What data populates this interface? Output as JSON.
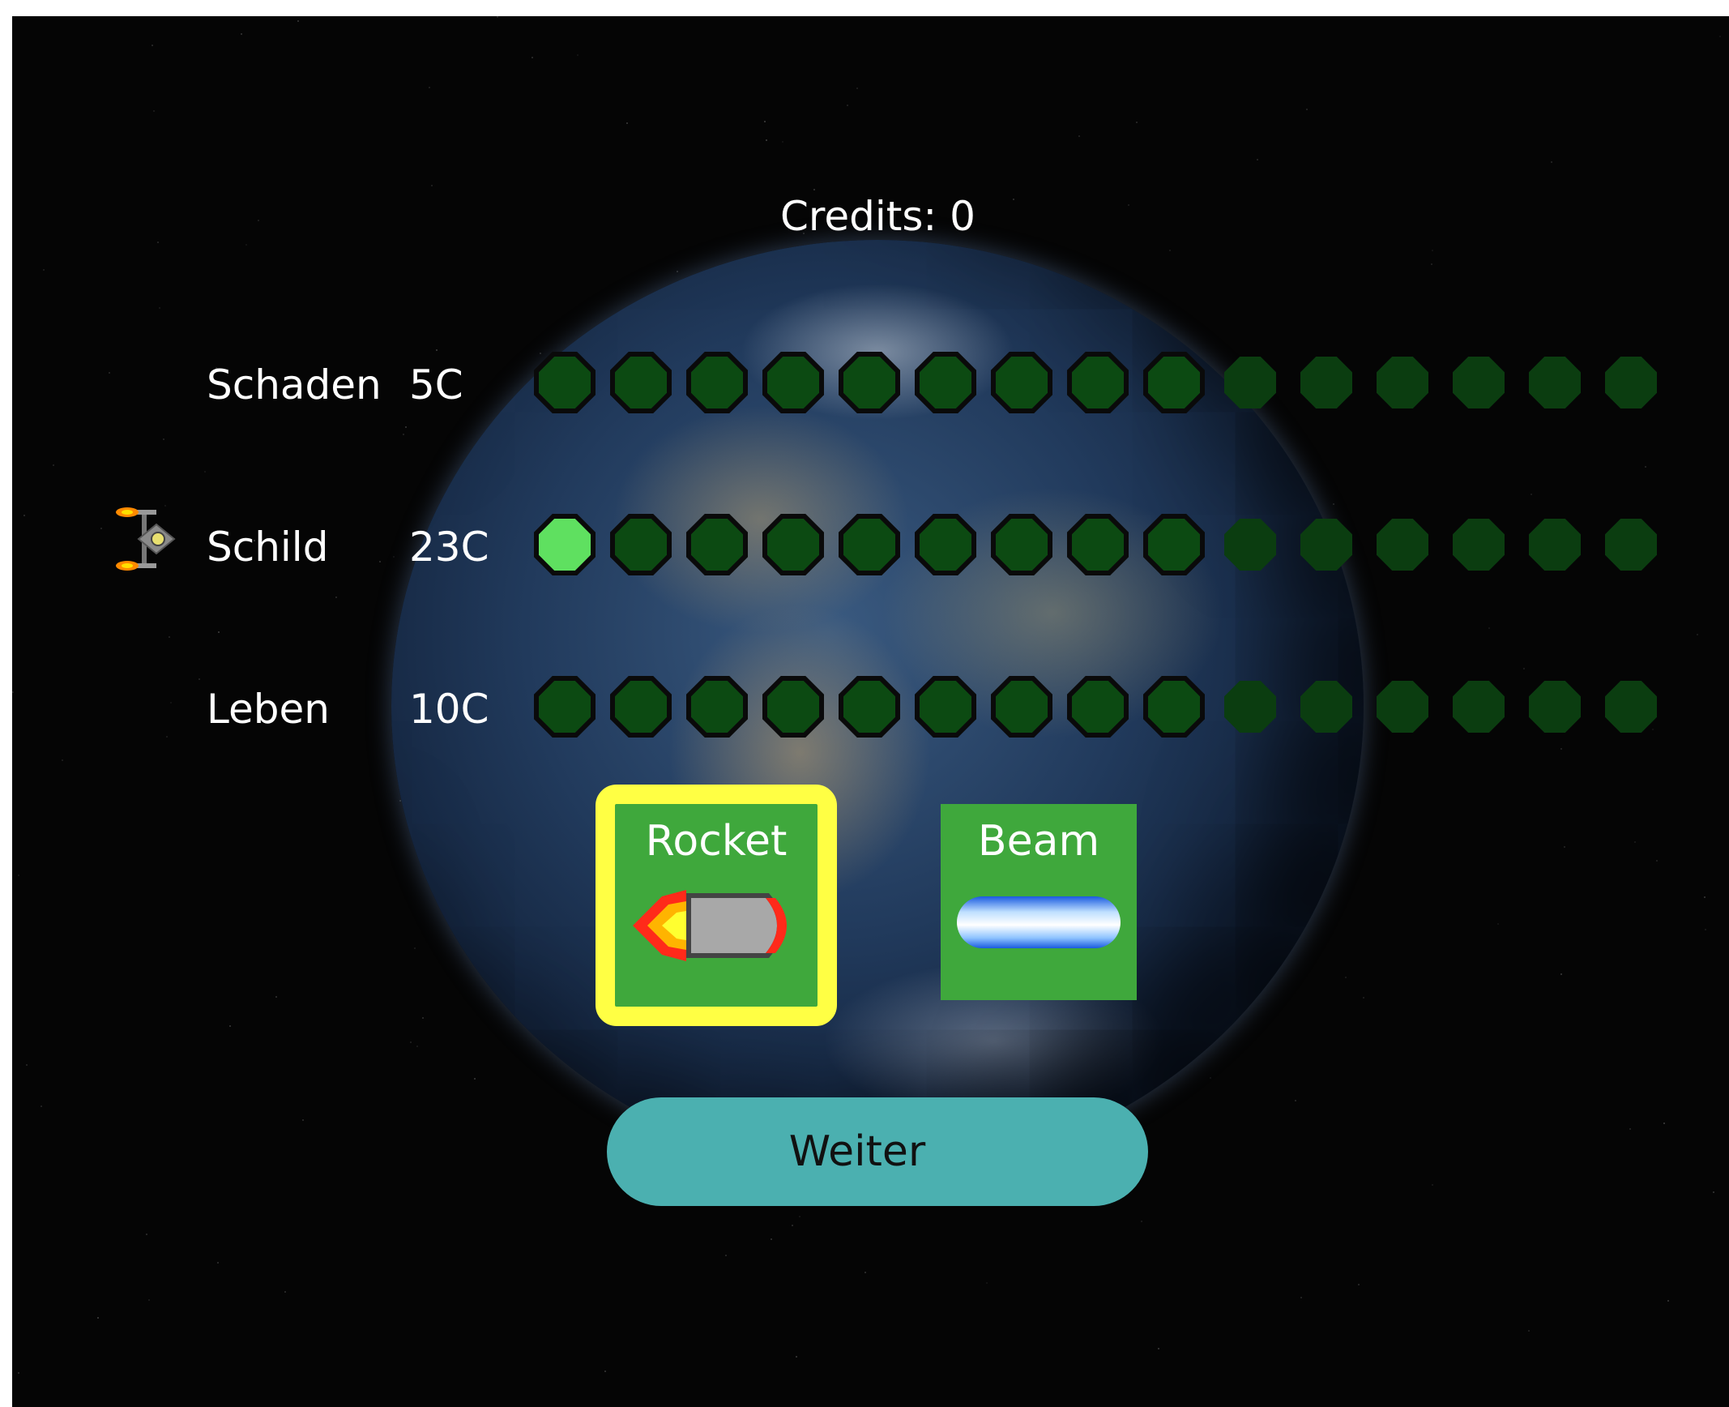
{
  "credits_text": "Credits: 0",
  "upgrades": [
    {
      "label": "Schaden",
      "cost": "5C",
      "levels_total": 15,
      "levels_filled": 0
    },
    {
      "label": "Schild",
      "cost": "23C",
      "levels_total": 15,
      "levels_filled": 1
    },
    {
      "label": "Leben",
      "cost": "10C",
      "levels_total": 15,
      "levels_filled": 0
    }
  ],
  "selected_upgrade_icon": "spaceship-icon",
  "weapons": [
    {
      "label": "Rocket",
      "icon": "rocket-icon",
      "selected": true
    },
    {
      "label": "Beam",
      "icon": "beam-icon",
      "selected": false
    }
  ],
  "continue_button": "Weiter",
  "colors": {
    "dot_empty": "#0c4a12",
    "dot_filled": "#5fe060",
    "weapon_card": "#3fa83c",
    "selection_border": "#ffff44",
    "button": "#4bb0b0"
  }
}
